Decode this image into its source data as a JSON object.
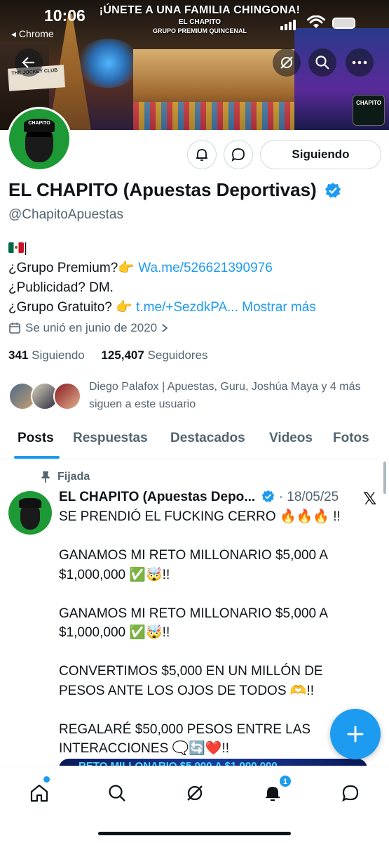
{
  "status_bar": {
    "time": "10:06",
    "back_app": "◂ Chrome"
  },
  "banner": {
    "title": "¡ÚNETE A UNA FAMILIA CHINGONA!",
    "line1": "EL CHAPITO",
    "line2": "GRUPO PREMIUM QUINCENAL",
    "sign_text": "THE JOCKEY CLUB",
    "logo_text": "CHAPITO"
  },
  "profile": {
    "name": "EL CHAPITO (Apuestas Deportivas)",
    "handle": "@ChapitoApuestas",
    "follow_label": "Siguiendo",
    "bio": {
      "line2_text": "¿Grupo Premium?👉 ",
      "line2_link": "Wa.me/526621390976",
      "line3_text": "¿Publicidad? DM.",
      "line4_text": "¿Grupo Gratuito? 👉 ",
      "line4_link": "t.me/+SezdkPA...",
      "show_more": "Mostrar más"
    },
    "joined": "Se unió en junio de 2020",
    "following_count": "341",
    "following_label": "Siguiendo",
    "followers_count": "125,407",
    "followers_label": "Seguidores",
    "known_followers": "Diego Palafox | Apuestas, Guru, Joshúa Maya y 4 más siguen a este usuario"
  },
  "tabs": [
    "Posts",
    "Respuestas",
    "Destacados",
    "Videos",
    "Fotos"
  ],
  "post": {
    "pinned_label": "Fijada",
    "author": "EL CHAPITO (Apuestas Depo...",
    "date": "· 18/05/25",
    "p1": "SE PRENDIÓ EL FUCKING CERRO 🔥🔥🔥 !!",
    "p2a": "GANAMOS MI RETO MILLONARIO $5,000 A $1,000,000 ✅🤯!!",
    "p2b": "GANAMOS MI RETO MILLONARIO $5,000 A $1,000,000 ✅🤯!!",
    "p3": "CONVERTIMOS $5,000 EN UN MILLÓN DE PESOS ANTE LOS OJOS DE TODOS 🫶!!",
    "p4": "REGALARÉ $50,000 PESOS ENTRE LAS INTERACCIONES 🗨️🔄❤️!!",
    "image_caption": "RETO MILLONARIO $5,000 A $1,000,000"
  },
  "bottom_nav": {
    "notifications_badge": "1"
  },
  "colors": {
    "accent": "#1d9bf0",
    "text": "#0f1419",
    "muted": "#536471",
    "avatar_green": "#1d9a35"
  }
}
